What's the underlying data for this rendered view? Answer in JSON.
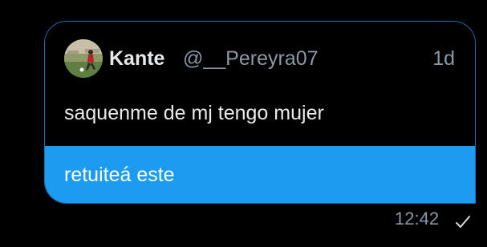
{
  "quoted_tweet": {
    "display_name": "Kante",
    "handle": "@__Pereyra07",
    "relative_time": "1d",
    "text": "saquenme de mj tengo mujer"
  },
  "message": {
    "text": "retuiteá este",
    "time": "12:42",
    "status_icon": "check-icon"
  },
  "colors": {
    "background": "#000000",
    "bubble_accent": "#1d9bf0",
    "border": "#1f6fb5",
    "primary_text": "#e7e9ea",
    "secondary_text": "#8b98a5"
  }
}
